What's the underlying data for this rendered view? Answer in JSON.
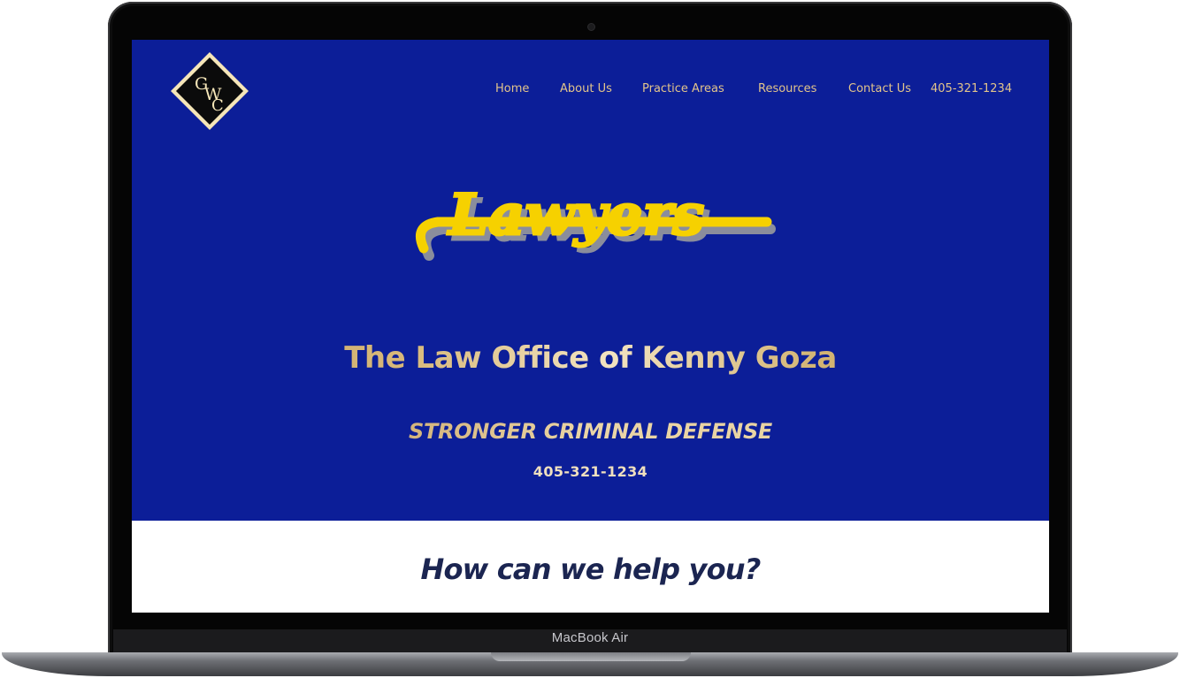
{
  "device": {
    "model_label": "MacBook Air"
  },
  "header": {
    "logo_text": "GWC",
    "nav": [
      {
        "label": "Home"
      },
      {
        "label": "About Us"
      },
      {
        "label": "Practice Areas"
      },
      {
        "label": "Resources"
      },
      {
        "label": "Contact Us"
      }
    ],
    "phone": "405-321-1234"
  },
  "hero": {
    "script_word": "Lawyers",
    "title": "The Law Office of Kenny Goza",
    "tagline": "STRONGER CRIMINAL DEFENSE",
    "phone": "405-321-1234"
  },
  "help": {
    "title": "How can we help you?"
  },
  "colors": {
    "hero_bg": "#0c1e98",
    "gold": "#e2c48b",
    "yellow": "#f6d100",
    "navy_text": "#1b2551"
  },
  "icons": {
    "logo": "diamond-monogram-logo",
    "camera": "camera-dot"
  }
}
